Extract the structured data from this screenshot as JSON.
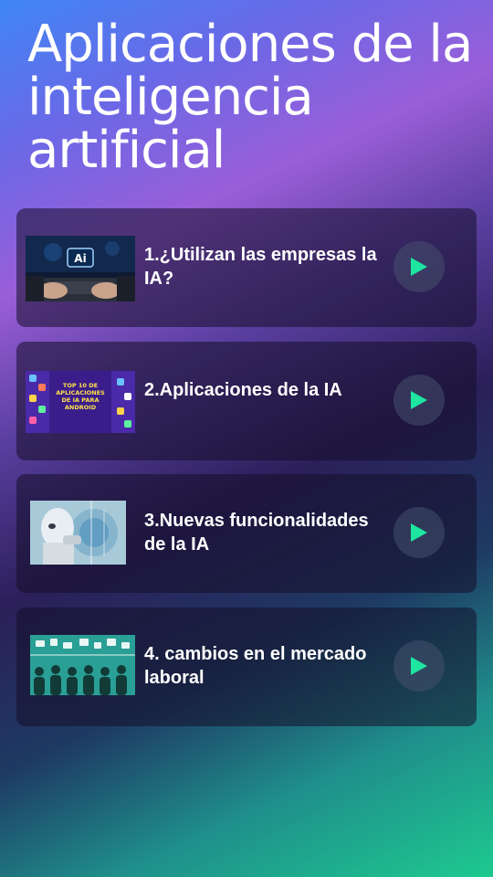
{
  "page": {
    "title": "Aplicaciones de la inteligencia artificial"
  },
  "colors": {
    "accent": "#1ee5a0",
    "gradient_top": "#3f86f5",
    "gradient_mid": "#9a5ed8",
    "gradient_bottom": "#1ec98f"
  },
  "cards": [
    {
      "label": "1.¿Utilizan las empresas la IA?",
      "thumbnail_text": "Ai",
      "icon": "play-icon"
    },
    {
      "label": "2.Aplicaciones de la IA",
      "thumbnail_text": "TOP 10 DE APLICACIONES DE IA PARA ANDROID",
      "icon": "play-icon"
    },
    {
      "label": "3.Nuevas funcionalidades de la IA",
      "icon": "play-icon"
    },
    {
      "label": "4. cambios en el mercado laboral",
      "icon": "play-icon"
    }
  ]
}
